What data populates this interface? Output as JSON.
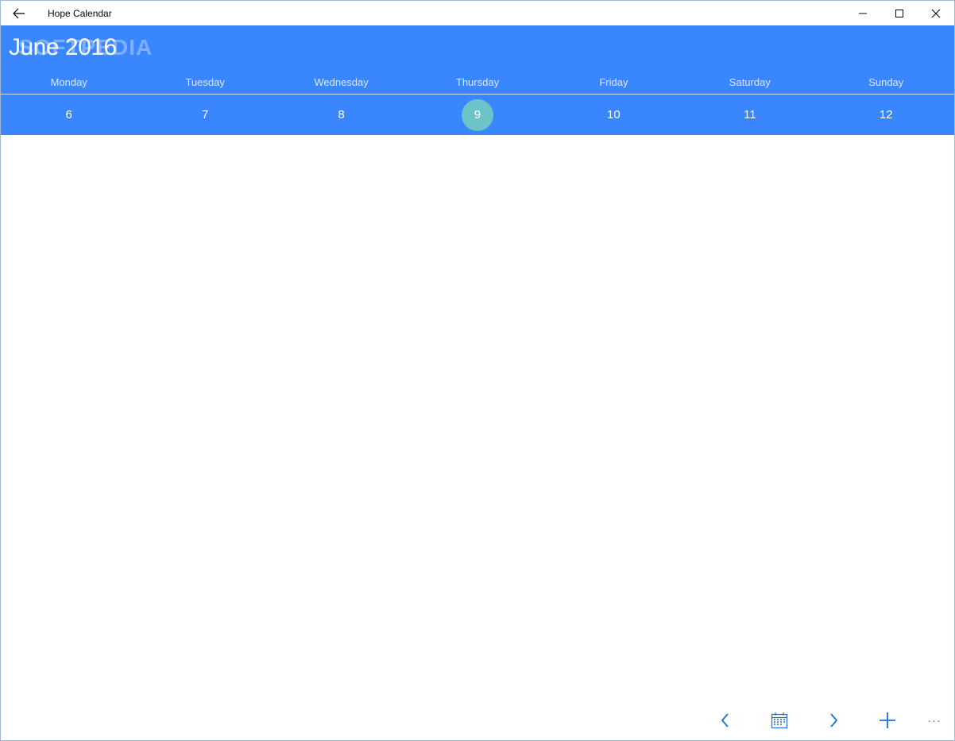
{
  "titlebar": {
    "app_title": "Hope Calendar",
    "back_icon": "back-arrow-icon",
    "minimize_icon": "minimize-icon",
    "maximize_icon": "maximize-icon",
    "close_icon": "close-icon"
  },
  "header": {
    "month_title": "June 2016",
    "watermark": "SOFTPEDIA",
    "accent_color": "#3a86ff",
    "today_color": "#6cc4c8"
  },
  "week": {
    "days": [
      {
        "name": "Monday",
        "date": "6",
        "today": false
      },
      {
        "name": "Tuesday",
        "date": "7",
        "today": false
      },
      {
        "name": "Wednesday",
        "date": "8",
        "today": false
      },
      {
        "name": "Thursday",
        "date": "9",
        "today": true
      },
      {
        "name": "Friday",
        "date": "10",
        "today": false
      },
      {
        "name": "Saturday",
        "date": "11",
        "today": false
      },
      {
        "name": "Sunday",
        "date": "12",
        "today": false
      }
    ]
  },
  "appbar": {
    "prev_icon": "chevron-left-icon",
    "calendar_icon": "calendar-icon",
    "next_icon": "chevron-right-icon",
    "add_icon": "plus-icon",
    "more_label": "···",
    "icon_color": "#1a6fd6"
  }
}
